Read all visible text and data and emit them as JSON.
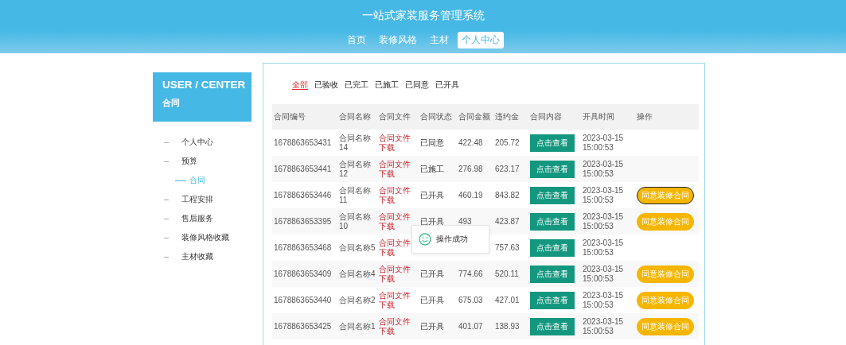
{
  "header": {
    "title": "一站式家装服务管理系统",
    "nav": [
      {
        "label": "首页",
        "selected": false
      },
      {
        "label": "装修风格",
        "selected": false
      },
      {
        "label": "主材",
        "selected": false
      },
      {
        "label": "个人中心",
        "selected": true
      }
    ]
  },
  "sidebar": {
    "title": "USER / CENTER",
    "subtitle": "合同",
    "items": [
      {
        "label": "个人中心",
        "selected": false
      },
      {
        "label": "预算",
        "selected": false,
        "children": [
          {
            "label": "合同",
            "selected": true
          }
        ]
      },
      {
        "label": "工程安排",
        "selected": false
      },
      {
        "label": "售后服务",
        "selected": false
      },
      {
        "label": "装修风格收藏",
        "selected": false
      },
      {
        "label": "主材收藏",
        "selected": false
      }
    ]
  },
  "filters": [
    {
      "label": "全部",
      "selected": true
    },
    {
      "label": "已验收",
      "selected": false
    },
    {
      "label": "已完工",
      "selected": false
    },
    {
      "label": "已施工",
      "selected": false
    },
    {
      "label": "已同意",
      "selected": false
    },
    {
      "label": "已开具",
      "selected": false
    }
  ],
  "table": {
    "columns": [
      "合同编号",
      "合同名称",
      "合同文件",
      "合同状态",
      "合同金额",
      "违约金",
      "合同内容",
      "开具时间",
      "操作"
    ],
    "rows": [
      {
        "id": "1678863653431",
        "name": "合同名称14",
        "file": "合同文件下载",
        "status": "已同意",
        "amount": "422.48",
        "penalty": "205.72",
        "view": "点击查看",
        "time": "2023-03-15 15:00:53",
        "action": null
      },
      {
        "id": "1678863653441",
        "name": "合同名称12",
        "file": "合同文件下载",
        "status": "已施工",
        "amount": "276.98",
        "penalty": "623.17",
        "view": "点击查看",
        "time": "2023-03-15 15:00:53",
        "action": null
      },
      {
        "id": "1678863653446",
        "name": "合同名称11",
        "file": "合同文件下载",
        "status": "已开具",
        "amount": "460.19",
        "penalty": "843.82",
        "view": "点击查看",
        "time": "2023-03-15 15:00:53",
        "action": "同意装修合同",
        "focused": true
      },
      {
        "id": "1678863653395",
        "name": "合同名称10",
        "file": "合同文件下载",
        "status": "已开具",
        "amount": "493",
        "penalty": "423.87",
        "view": "点击查看",
        "time": "2023-03-15 15:00:53",
        "action": "同意装修合同",
        "focused": false
      },
      {
        "id": "1678863653468",
        "name": "合同名称5",
        "file": "合同文件下载",
        "status": null,
        "amount": null,
        "penalty": "757.63",
        "view": "点击查看",
        "time": "2023-03-15 15:00:53",
        "action": null
      },
      {
        "id": "1678863653409",
        "name": "合同名称4",
        "file": "合同文件下载",
        "status": "已开具",
        "amount": "774.66",
        "penalty": "520.11",
        "view": "点击查看",
        "time": "2023-03-15 15:00:53",
        "action": "同意装修合同",
        "focused": false
      },
      {
        "id": "1678863653440",
        "name": "合同名称2",
        "file": "合同文件下载",
        "status": "已开具",
        "amount": "675.03",
        "penalty": "427.01",
        "view": "点击查看",
        "time": "2023-03-15 15:00:53",
        "action": "同意装修合同",
        "focused": false
      },
      {
        "id": "1678863653425",
        "name": "合同名称1",
        "file": "合同文件下载",
        "status": "已开具",
        "amount": "401.07",
        "penalty": "138.93",
        "view": "点击查看",
        "time": "2023-03-15 15:00:53",
        "action": "同意装修合同",
        "focused": false
      }
    ]
  },
  "toast": {
    "message": "操作成功"
  }
}
